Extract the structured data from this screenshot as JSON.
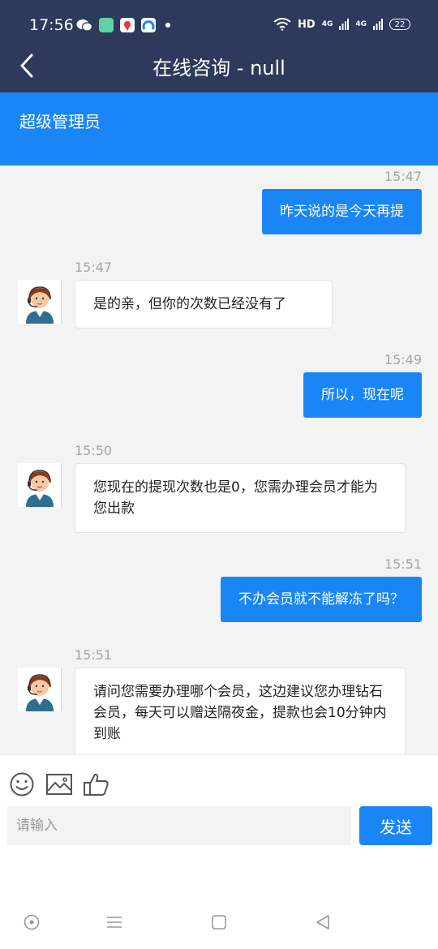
{
  "status_bar": {
    "time": "17:56",
    "network_label": "HD",
    "signal_1": "4G",
    "signal_2": "4G",
    "battery": "22"
  },
  "header": {
    "title": "在线咨询 - null"
  },
  "banner": {
    "agent_name": "超级管理员"
  },
  "messages": [
    {
      "side": "out",
      "time": "15:47",
      "text": "昨天说的是今天再提"
    },
    {
      "side": "in",
      "time": "15:47",
      "text": "是的亲，但你的次数已经没有了"
    },
    {
      "side": "out",
      "time": "15:49",
      "text": "所以，现在呢"
    },
    {
      "side": "in",
      "time": "15:50",
      "text": "您现在的提现次数也是0，您需办理会员才能为您出款"
    },
    {
      "side": "out",
      "time": "15:51",
      "text": "不办会员就不能解冻了吗？"
    },
    {
      "side": "in",
      "time": "15:51",
      "text": "请问您需要办理哪个会员，这边建议您办理钻石会员，每天可以赠送隔夜金，提款也会10分钟内到账"
    }
  ],
  "input": {
    "placeholder": "请输入",
    "send_label": "发送"
  },
  "colors": {
    "header_bg": "#2d3a5b",
    "accent": "#1a86f5",
    "chat_bg": "#f3f3f3"
  }
}
